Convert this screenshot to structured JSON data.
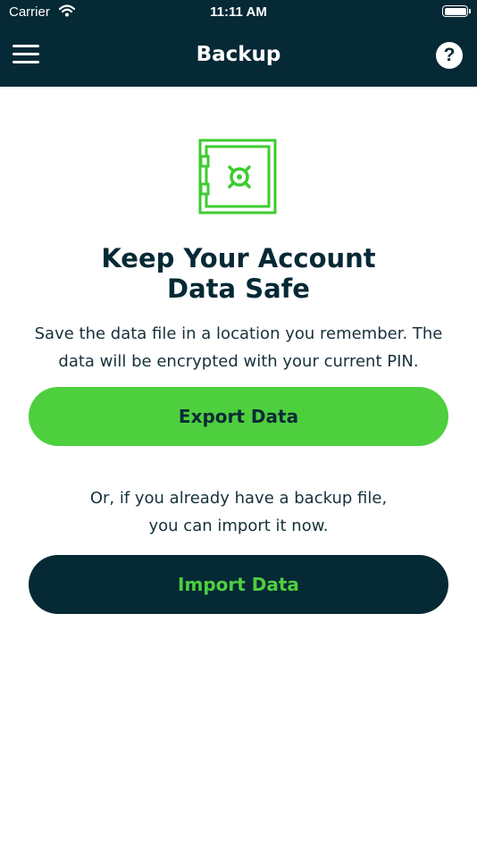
{
  "status_bar": {
    "carrier": "Carrier",
    "time": "11:11 AM"
  },
  "nav": {
    "title": "Backup",
    "help_label": "?"
  },
  "icons": {
    "menu": "hamburger-menu-icon",
    "help": "question-mark-icon",
    "safe": "safe-vault-icon",
    "wifi": "wifi-icon",
    "battery": "battery-icon"
  },
  "colors": {
    "navbar_bg": "#052935",
    "accent_green": "#4ecf3e",
    "text_dark": "#052935"
  },
  "content": {
    "heading_line1": "Keep Your Account",
    "heading_line2": "Data Safe",
    "description_line1": "Save the data file in a location you remember. The",
    "description_line2": "data will be encrypted with your current PIN.",
    "export_label": "Export Data",
    "or_line1": "Or, if you already have a backup file,",
    "or_line2": "you can import it now.",
    "import_label": "Import Data"
  }
}
